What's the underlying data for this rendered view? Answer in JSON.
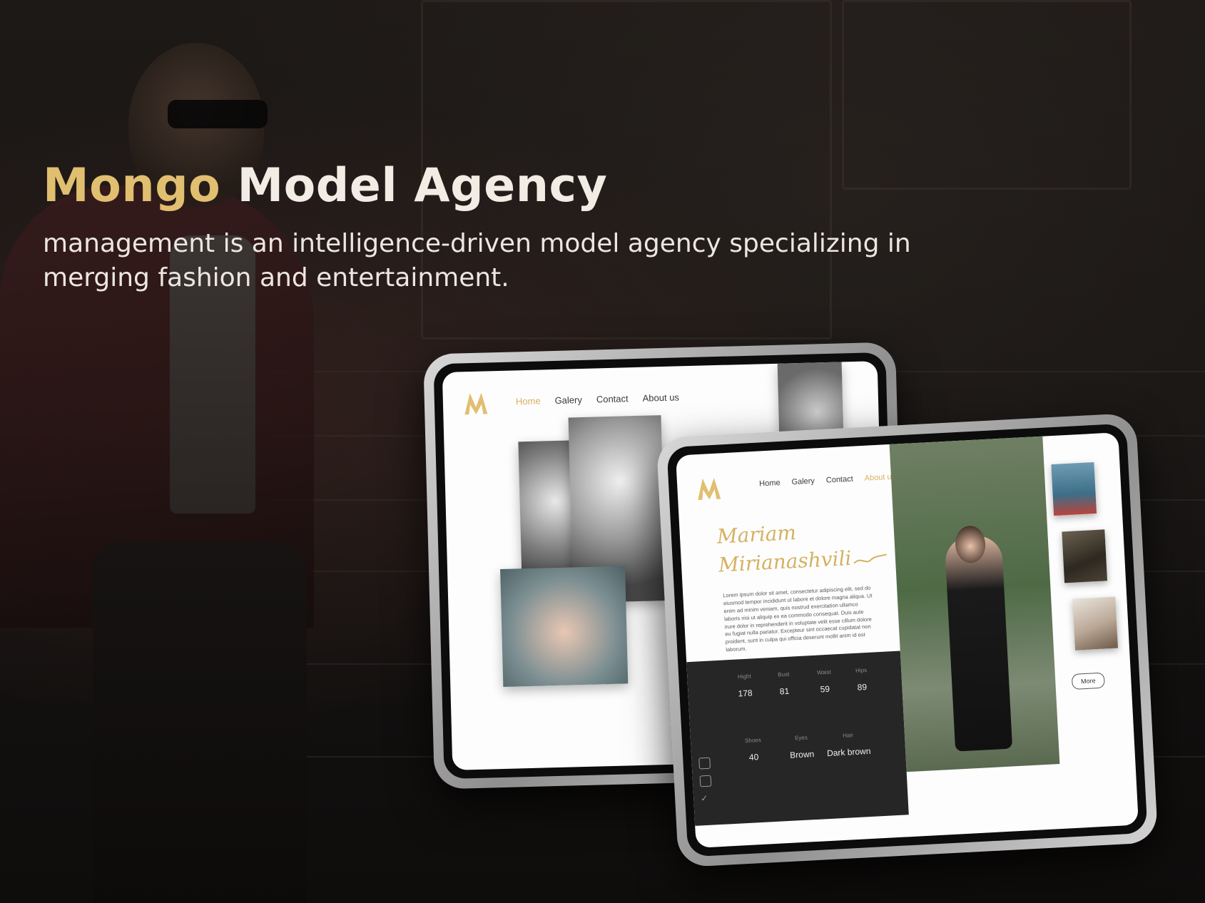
{
  "hero": {
    "brand_gold": "Mongo",
    "brand_rest": "Model Agency",
    "tagline": "management is an intelligence-driven model agency specializing in merging fashion and entertainment."
  },
  "tablet_home": {
    "nav": [
      "Home",
      "Galery",
      "Contact",
      "About us"
    ],
    "active_nav": "Home"
  },
  "tablet_profile": {
    "nav": [
      "Home",
      "Galery",
      "Contact",
      "About us"
    ],
    "active_nav": "About us",
    "first_name": "Mariam",
    "last_name": "Mirianashvili",
    "bio": "Lorem ipsum dolor sit amet, consectetur adipiscing elit, sed do eiusmod tempor incididunt ut labore et dolore magna aliqua. Ut enim ad minim veniam, quis nostrud exercitation ullamco laboris nisi ut aliquip ex ea commodo consequat. Duis aute irure dolor in reprehenderit in voluptate velit esse cillum dolore eu fugiat nulla pariatur. Excepteur sint occaecat cupidatat non proident, sunt in culpa qui officia deserunt mollit anim id est laborum.",
    "stats": [
      {
        "label": "Hight",
        "value": "178"
      },
      {
        "label": "Bust",
        "value": "81"
      },
      {
        "label": "Waist",
        "value": "59"
      },
      {
        "label": "Hips",
        "value": "89"
      },
      {
        "label": "Shoes",
        "value": "40"
      },
      {
        "label": "Eyes",
        "value": "Brown"
      },
      {
        "label": "Hair",
        "value": "Dark brown"
      }
    ],
    "more_label": "More"
  },
  "colors": {
    "accent_gold": "#e1bf70",
    "dark_panel": "#262626",
    "background": "#141211"
  },
  "icons": [
    "logo-m-icon",
    "instagram-icon",
    "facebook-icon",
    "twitter-icon"
  ]
}
